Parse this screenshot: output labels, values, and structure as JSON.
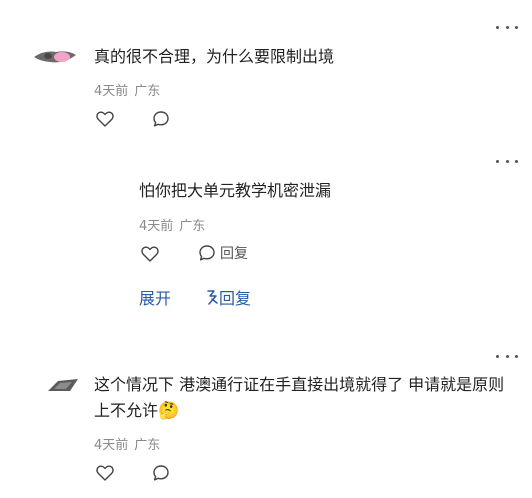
{
  "comments": [
    {
      "text": "真的很不合理，为什么要限制出境",
      "time": "4天前",
      "location": "广东"
    },
    {
      "text": "这个情况下 港澳通行证在手直接出境就得了 申请就是原则上不允许",
      "emoji": "🤔",
      "time": "4天前",
      "location": "广东"
    }
  ],
  "reply": {
    "text": "怕你把大单元教学机密泄漏",
    "time": "4天前",
    "location": "广东",
    "reply_label": "回复"
  },
  "thread_actions": {
    "expand_label": "展开",
    "collapse_label": "回复"
  },
  "icons": [
    "more-icon",
    "like-icon",
    "comment-icon",
    "expand-icon"
  ]
}
